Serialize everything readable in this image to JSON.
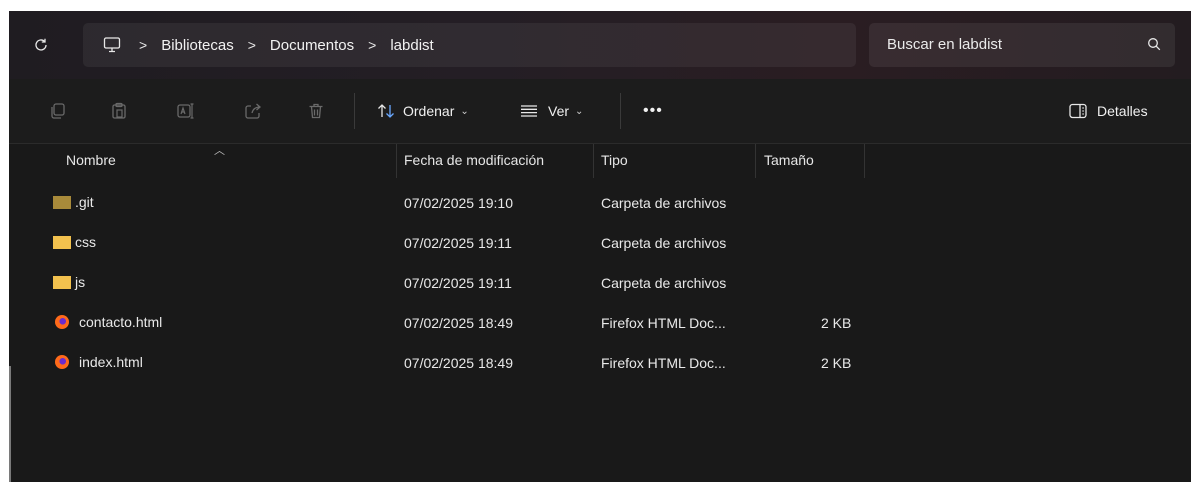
{
  "breadcrumb": [
    "Bibliotecas",
    "Documentos",
    "labdist"
  ],
  "breadcrumb_separator": ">",
  "search": {
    "placeholder": "Buscar en labdist"
  },
  "toolbar": {
    "icons": [
      "copy-icon",
      "paste-icon",
      "rename-icon",
      "share-icon",
      "delete-icon"
    ],
    "sort_label": "Ordenar",
    "view_label": "Ver",
    "more_label": "•••",
    "details_label": "Detalles"
  },
  "columns": {
    "name": "Nombre",
    "modified": "Fecha de modificación",
    "type": "Tipo",
    "size": "Tamaño",
    "sorted_by": "name"
  },
  "files": [
    {
      "name": ".git",
      "modified": "07/02/2025 19:10",
      "type": "Carpeta de archivos",
      "size": "",
      "icon": "folder-dark-icon"
    },
    {
      "name": "css",
      "modified": "07/02/2025 19:11",
      "type": "Carpeta de archivos",
      "size": "",
      "icon": "folder-icon"
    },
    {
      "name": "js",
      "modified": "07/02/2025 19:11",
      "type": "Carpeta de archivos",
      "size": "",
      "icon": "folder-icon"
    },
    {
      "name": "contacto.html",
      "modified": "07/02/2025 18:49",
      "type": "Firefox HTML Doc...",
      "size": "2 KB",
      "icon": "firefox-icon"
    },
    {
      "name": "index.html",
      "modified": "07/02/2025 18:49",
      "type": "Firefox HTML Doc...",
      "size": "2 KB",
      "icon": "firefox-icon"
    }
  ],
  "colors": {
    "background": "#191919",
    "folder": "#f2c14e",
    "folder_dark": "#a88a3a"
  }
}
